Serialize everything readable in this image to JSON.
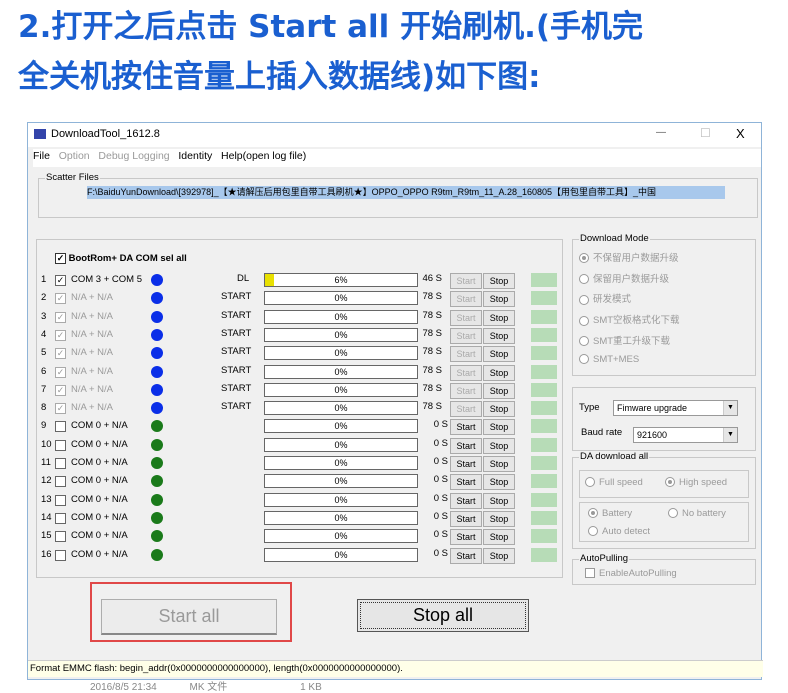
{
  "heading": {
    "line1": "2.打开之后点击 Start all  开始刷机.(手机完",
    "line2": "全关机按住音量上插入数据线)如下图:"
  },
  "window": {
    "title": "DownloadTool_1612.8",
    "minimize": "—",
    "maximize": "☐",
    "close": "X"
  },
  "menu": [
    "File",
    "Option",
    "Debug Logging",
    "Identity",
    "Help(open log file)"
  ],
  "scatter": {
    "label": "Scatter Files",
    "path": "F:\\BaiduYunDownload\\[392978]_【★请解压后用包里自带工具刷机★】OPPO_OPPO R9tm_R9tm_11_A.28_160805【用包里自带工具】_中国"
  },
  "select_all": "BootRom+ DA COM sel all",
  "ports": [
    {
      "n": "1",
      "name": "COM 3 + COM 5",
      "checked": true,
      "enabled": true,
      "dot": "#0a2ee8",
      "status": "DL",
      "progress": 6,
      "pct": "6%",
      "time": "46 S",
      "start_enabled": false,
      "stop": "Stop"
    },
    {
      "n": "2",
      "name": "N/A + N/A",
      "checked": true,
      "enabled": false,
      "dot": "#0a2ee8",
      "status": "START",
      "progress": 0,
      "pct": "0%",
      "time": "78 S",
      "start_enabled": false,
      "stop": "Stop"
    },
    {
      "n": "3",
      "name": "N/A + N/A",
      "checked": true,
      "enabled": false,
      "dot": "#0a2ee8",
      "status": "START",
      "progress": 0,
      "pct": "0%",
      "time": "78 S",
      "start_enabled": false,
      "stop": "Stop"
    },
    {
      "n": "4",
      "name": "N/A + N/A",
      "checked": true,
      "enabled": false,
      "dot": "#0a2ee8",
      "status": "START",
      "progress": 0,
      "pct": "0%",
      "time": "78 S",
      "start_enabled": false,
      "stop": "Stop"
    },
    {
      "n": "5",
      "name": "N/A + N/A",
      "checked": true,
      "enabled": false,
      "dot": "#0a2ee8",
      "status": "START",
      "progress": 0,
      "pct": "0%",
      "time": "78 S",
      "start_enabled": false,
      "stop": "Stop"
    },
    {
      "n": "6",
      "name": "N/A + N/A",
      "checked": true,
      "enabled": false,
      "dot": "#0a2ee8",
      "status": "START",
      "progress": 0,
      "pct": "0%",
      "time": "78 S",
      "start_enabled": false,
      "stop": "Stop"
    },
    {
      "n": "7",
      "name": "N/A + N/A",
      "checked": true,
      "enabled": false,
      "dot": "#0a2ee8",
      "status": "START",
      "progress": 0,
      "pct": "0%",
      "time": "78 S",
      "start_enabled": false,
      "stop": "Stop"
    },
    {
      "n": "8",
      "name": "N/A + N/A",
      "checked": true,
      "enabled": false,
      "dot": "#0a2ee8",
      "status": "START",
      "progress": 0,
      "pct": "0%",
      "time": "78 S",
      "start_enabled": false,
      "stop": "Stop"
    },
    {
      "n": "9",
      "name": "COM 0 + N/A",
      "checked": false,
      "enabled": true,
      "dot": "#1a7a1a",
      "status": "",
      "progress": 0,
      "pct": "0%",
      "time": "0 S",
      "start_enabled": true,
      "stop": "Stop"
    },
    {
      "n": "10",
      "name": "COM 0 + N/A",
      "checked": false,
      "enabled": true,
      "dot": "#1a7a1a",
      "status": "",
      "progress": 0,
      "pct": "0%",
      "time": "0 S",
      "start_enabled": true,
      "stop": "Stop"
    },
    {
      "n": "11",
      "name": "COM 0 + N/A",
      "checked": false,
      "enabled": true,
      "dot": "#1a7a1a",
      "status": "",
      "progress": 0,
      "pct": "0%",
      "time": "0 S",
      "start_enabled": true,
      "stop": "Stop"
    },
    {
      "n": "12",
      "name": "COM 0 + N/A",
      "checked": false,
      "enabled": true,
      "dot": "#1a7a1a",
      "status": "",
      "progress": 0,
      "pct": "0%",
      "time": "0 S",
      "start_enabled": true,
      "stop": "Stop"
    },
    {
      "n": "13",
      "name": "COM 0 + N/A",
      "checked": false,
      "enabled": true,
      "dot": "#1a7a1a",
      "status": "",
      "progress": 0,
      "pct": "0%",
      "time": "0 S",
      "start_enabled": true,
      "stop": "Stop"
    },
    {
      "n": "14",
      "name": "COM 0 + N/A",
      "checked": false,
      "enabled": true,
      "dot": "#1a7a1a",
      "status": "",
      "progress": 0,
      "pct": "0%",
      "time": "0 S",
      "start_enabled": true,
      "stop": "Stop"
    },
    {
      "n": "15",
      "name": "COM 0 + N/A",
      "checked": false,
      "enabled": true,
      "dot": "#1a7a1a",
      "status": "",
      "progress": 0,
      "pct": "0%",
      "time": "0 S",
      "start_enabled": true,
      "stop": "Stop"
    },
    {
      "n": "16",
      "name": "COM 0 + N/A",
      "checked": false,
      "enabled": true,
      "dot": "#1a7a1a",
      "status": "",
      "progress": 0,
      "pct": "0%",
      "time": "0 S",
      "start_enabled": true,
      "stop": "Stop"
    }
  ],
  "start_label": "Start",
  "download_mode": {
    "label": "Download Mode",
    "options": [
      "不保留用户数据升级",
      "保留用户数据升级",
      "研发模式",
      "SMT空板格式化下载",
      "SMT重工升级下载",
      "SMT+MES"
    ],
    "selected": 0
  },
  "type": {
    "label": "Type",
    "value": "Fimware upgrade"
  },
  "baud": {
    "label": "Baud rate",
    "value": "921600"
  },
  "da": {
    "label": "DA download all",
    "full": "Full speed",
    "high": "High speed",
    "battery": "Battery",
    "nobattery": "No battery",
    "auto": "Auto detect"
  },
  "autopulling": {
    "label": "AutoPulling",
    "checkbox": "EnableAutoPulling"
  },
  "buttons": {
    "start_all": "Start all",
    "stop_all": "Stop all"
  },
  "status": "Format EMMC flash:  begin_addr(0x0000000000000000), length(0x0000000000000000).",
  "background_row": {
    "date": "2016/8/5 21:34",
    "type": "MK 文件",
    "size": "1 KB"
  },
  "highlight_color": "#e04848"
}
